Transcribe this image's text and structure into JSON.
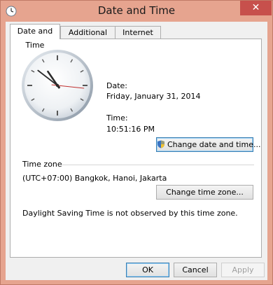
{
  "window": {
    "title": "Date and Time",
    "close_glyph": "✕"
  },
  "tabs": [
    {
      "label": "Date and Time",
      "active": true
    },
    {
      "label": "Additional Clocks",
      "active": false
    },
    {
      "label": "Internet Time",
      "active": false
    }
  ],
  "date": {
    "label": "Date:",
    "value": "Friday, January 31, 2014"
  },
  "time": {
    "label": "Time:",
    "value": "10:51:16 PM"
  },
  "change_datetime_button": {
    "label": "Change date and time...",
    "icon": "uac-shield-icon"
  },
  "timezone": {
    "heading": "Time zone",
    "value": "(UTC+07:00) Bangkok, Hanoi, Jakarta",
    "change_button": "Change time zone..."
  },
  "dst_note": "Daylight Saving Time is not observed by this time zone.",
  "footer": {
    "ok": "OK",
    "cancel": "Cancel",
    "apply": "Apply"
  },
  "clock": {
    "hours": 10,
    "minutes": 51,
    "seconds": 16
  }
}
